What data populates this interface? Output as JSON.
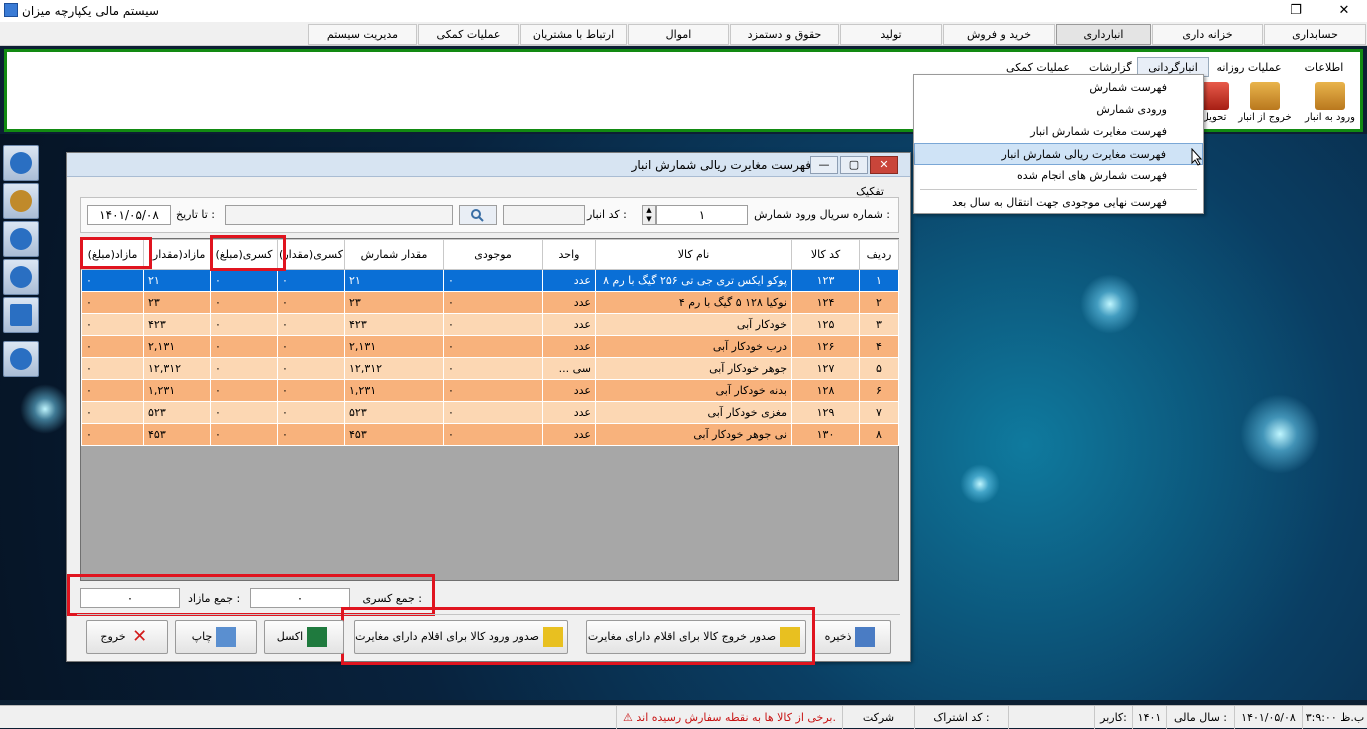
{
  "window": {
    "title": "سیستم مالی یکپارچه میزان",
    "restore_glyph": "❐",
    "close_glyph": "✕"
  },
  "menu": [
    "حسابداری",
    "خزانه داری",
    "انبارداری",
    "خرید و فروش",
    "تولید",
    "حقوق و دستمزد",
    "اموال",
    "ارتباط با مشتریان",
    "عملیات کمکی",
    "مدیریت سیستم"
  ],
  "subtabs": [
    "اطلاعات پایه",
    "عملیات روزانه",
    "انبارگردانی",
    "گزارشات",
    "عملیات کمکی"
  ],
  "ribbon_buttons": [
    "ورود به انبار",
    "خروج از انبار",
    "تحویل"
  ],
  "dropdown": [
    "فهرست شمارش",
    "ورودی شمارش",
    "فهرست مغایرت شمارش انبار",
    "فهرست مغایرت ریالی شمارش انبار",
    "فهرست شمارش های انجام شده",
    "فهرست نهایی موجودی جهت انتقال به سال بعد"
  ],
  "dialog": {
    "title": "فهرست مغایرت ریالی شمارش انبار",
    "tafkik": "تفکیک",
    "serial_label": "شماره سریال ورود شمارش :",
    "serial_value": "۱",
    "warehouse_label": "کد انبار :",
    "warehouse_value": "",
    "date_label": "تا تاریخ :",
    "date_value": "۱۴۰۱/۰۵/۰۸",
    "columns": [
      "ردیف",
      "کد کالا",
      "نام کالا",
      "واحد",
      "موجودی",
      "مقدار شمارش",
      "کسری(مقدار)",
      "کسری(مبلغ)",
      "مازاد(مقدار)",
      "مازاد(مبلغ)"
    ],
    "rows": [
      [
        "۱",
        "۱۲۳",
        "پوکو ایکس تری جی تی ۲۵۶ گیگ با رم ۸",
        "عدد",
        "۰",
        "۲۱",
        "۰",
        "۰",
        "۲۱",
        "۰"
      ],
      [
        "۲",
        "۱۲۴",
        "نوکیا ۱۲۸ ۵ گیگ با رم ۴",
        "عدد",
        "۰",
        "۲۳",
        "۰",
        "۰",
        "۲۳",
        "۰"
      ],
      [
        "۳",
        "۱۲۵",
        "خودکار آبی",
        "عدد",
        "۰",
        "۴۲۳",
        "۰",
        "۰",
        "۴۲۳",
        "۰"
      ],
      [
        "۴",
        "۱۲۶",
        "درب خودکار آبی",
        "عدد",
        "۰",
        "۲,۱۳۱",
        "۰",
        "۰",
        "۲,۱۳۱",
        "۰"
      ],
      [
        "۵",
        "۱۲۷",
        "جوهر خودکار آبی",
        "سی ...",
        "۰",
        "۱۲,۳۱۲",
        "۰",
        "۰",
        "۱۲,۳۱۲",
        "۰"
      ],
      [
        "۶",
        "۱۲۸",
        "بدنه خودکار آبی",
        "عدد",
        "۰",
        "۱,۲۳۱",
        "۰",
        "۰",
        "۱,۲۳۱",
        "۰"
      ],
      [
        "۷",
        "۱۲۹",
        "مغزی خودکار آبی",
        "عدد",
        "۰",
        "۵۲۳",
        "۰",
        "۰",
        "۵۲۳",
        "۰"
      ],
      [
        "۸",
        "۱۳۰",
        "نی جوهر خودکار آبی",
        "عدد",
        "۰",
        "۴۵۳",
        "۰",
        "۰",
        "۴۵۳",
        "۰"
      ]
    ],
    "sum_kasri_label": "جمع کسری :",
    "sum_kasri_value": "۰",
    "sum_mazad_label": "جمع مازاد :",
    "sum_mazad_value": "۰",
    "buttons": {
      "save": "ذخیره",
      "issue_exit": "صدور خروج کالا برای اقلام دارای مغایرت",
      "issue_entry": "صدور ورود کالا برای اقلام دارای مغایرت",
      "excel": "اکسل",
      "print": "چاپ",
      "exit": "خروج"
    }
  },
  "status": {
    "warning": "برخی از کالا ها به نقطه سفارش رسیده اند.",
    "company_label": "شرکت",
    "subscription_label": "کد اشتراک :",
    "user_label": "کاربر:",
    "year_value": "۱۴۰۱",
    "year_label": "سال مالی :",
    "date": "۱۴۰۱/۰۵/۰۸",
    "time": "۳:۹:۰۰ ب.ظ"
  },
  "colors": {
    "highlight": "#e0141f",
    "ribbon_border": "#128a12",
    "row_orange": "#f8b27c",
    "row_light": "#fcd7b3",
    "selected_row": "#0a6fd6"
  }
}
